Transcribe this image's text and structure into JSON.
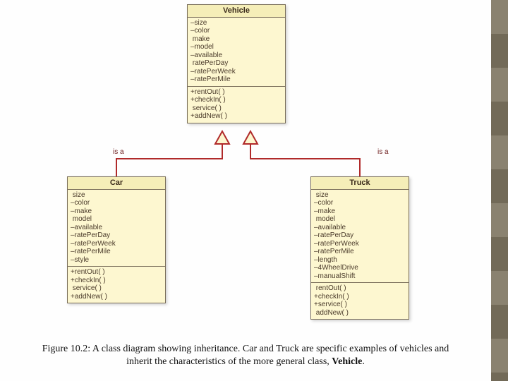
{
  "diagram": {
    "parent": {
      "name": "Vehicle",
      "attributes": [
        "–size",
        "–color",
        " make",
        "–model",
        "–available",
        " ratePerDay",
        "–ratePerWeek",
        "–ratePerMile"
      ],
      "methods": [
        "+rentOut( )",
        "+checkIn( )",
        " service( )",
        "+addNew( )"
      ]
    },
    "leftChild": {
      "name": "Car",
      "attributes": [
        " size",
        "–color",
        "–make",
        " model",
        "–available",
        "–ratePerDay",
        "–ratePerWeek",
        "–ratePerMile",
        "–style"
      ],
      "methods": [
        "+rentOut( )",
        "+checkIn( )",
        " service( )",
        "+addNew( )"
      ]
    },
    "rightChild": {
      "name": "Truck",
      "attributes": [
        " size",
        "–color",
        "–make",
        " model",
        "–available",
        "–ratePerDay",
        "–ratePerWeek",
        "–ratePerMile",
        "–length",
        "–4WheelDrive",
        "–manualShift"
      ],
      "methods": [
        " rentOut( )",
        "+checkIn( )",
        "+service( )",
        " addNew( )"
      ]
    },
    "relation_label": "is a"
  },
  "caption": {
    "prefix": "Figure  10.2: A class diagram showing inheritance. Car and Truck are specific examples of vehicles and inherit the characteristics of the more general class, ",
    "bold": "Vehicle",
    "suffix": "."
  }
}
